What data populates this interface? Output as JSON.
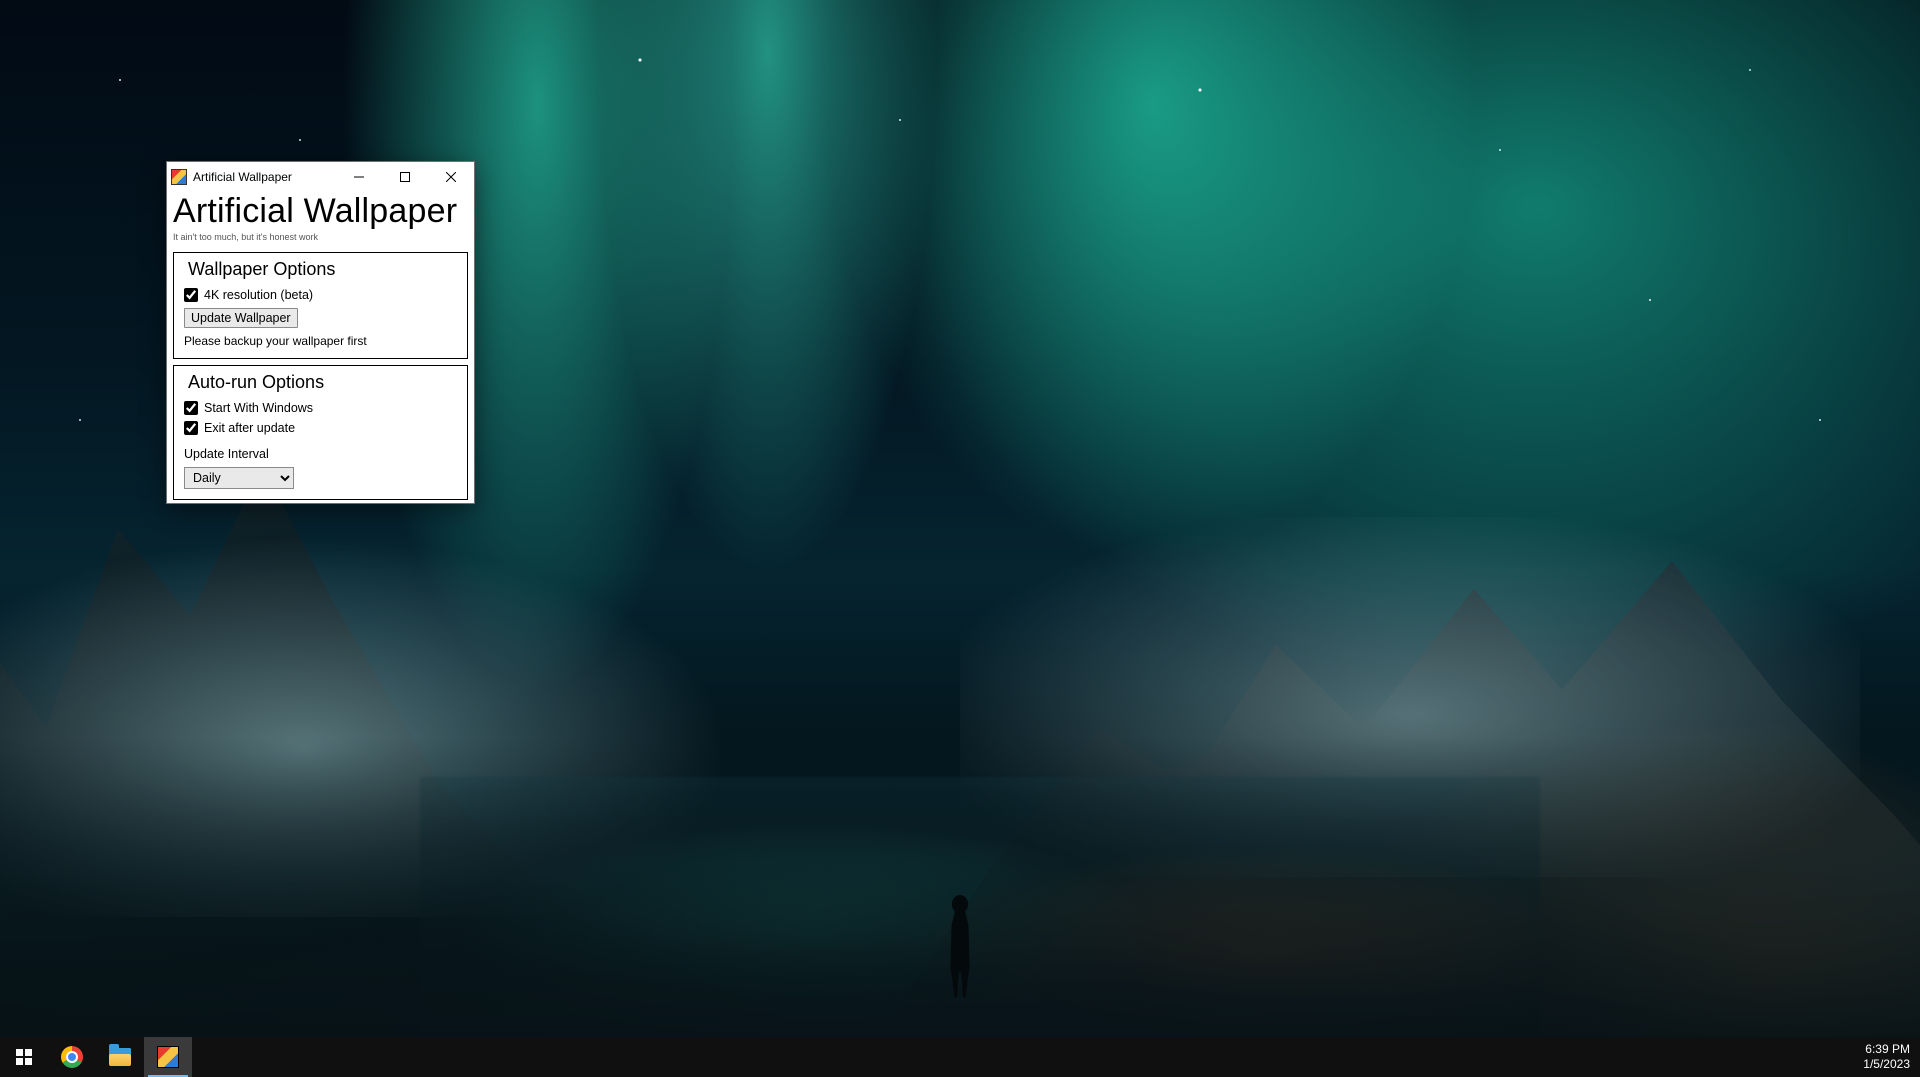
{
  "window": {
    "title": "Artificial Wallpaper",
    "heading": "Artificial Wallpaper",
    "subtitle": "It ain't too much, but it's honest work",
    "wallpaper_section": {
      "title": "Wallpaper Options",
      "chk_4k_label": "4K resolution (beta)",
      "chk_4k_checked": true,
      "update_btn": "Update Wallpaper",
      "hint": "Please backup your wallpaper first"
    },
    "autorun_section": {
      "title": "Auto-run Options",
      "chk_start_label": "Start With Windows",
      "chk_start_checked": true,
      "chk_exit_label": "Exit after update",
      "chk_exit_checked": true,
      "interval_label": "Update Interval",
      "interval_value": "Daily"
    }
  },
  "taskbar": {
    "time": "6:39 PM",
    "date": "1/5/2023"
  }
}
